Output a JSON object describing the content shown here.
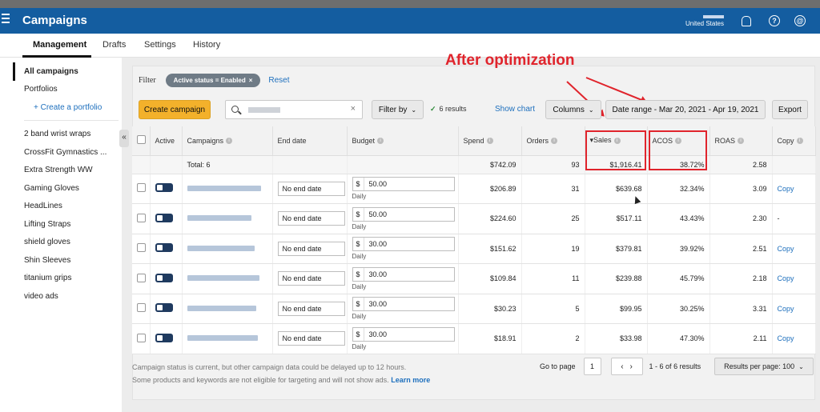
{
  "app": {
    "title": "Campaigns",
    "country": "United States"
  },
  "header_icons": [
    "bell-icon",
    "help-icon",
    "account-icon"
  ],
  "tabs": [
    {
      "label": "Management",
      "active": true
    },
    {
      "label": "Drafts",
      "active": false
    },
    {
      "label": "Settings",
      "active": false
    },
    {
      "label": "History",
      "active": false
    }
  ],
  "sidebar": {
    "top_items": [
      "All campaigns",
      "Portfolios"
    ],
    "create_portfolio": "+ Create a portfolio",
    "portfolios": [
      "2 band wrist wraps",
      "CrossFit Gymnastics ...",
      "Extra Strength WW",
      "Gaming Gloves",
      "HeadLines",
      "Lifting Straps",
      "shield gloves",
      "Shin Sleeves",
      "titanium grips",
      "video ads"
    ]
  },
  "filter": {
    "label": "Filter",
    "chip": "Active status = Enabled",
    "reset": "Reset"
  },
  "annotation": "After optimization",
  "toolbar": {
    "create": "Create campaign",
    "filter_by": "Filter by",
    "results": "6 results",
    "show_chart": "Show chart",
    "columns": "Columns",
    "date_range": "Date range - Mar 20, 2021 - Apr 19, 2021",
    "export": "Export"
  },
  "table": {
    "headers": {
      "active": "Active",
      "campaigns": "Campaigns",
      "end_date": "End date",
      "budget": "Budget",
      "spend": "Spend",
      "orders": "Orders",
      "sales": "Sales",
      "acos": "ACOS",
      "roas": "ROAS",
      "copy": "Copy"
    },
    "total": {
      "label": "Total: 6",
      "spend": "$742.09",
      "orders": "93",
      "sales": "$1,916.41",
      "acos": "38.72%",
      "roas": "2.58"
    },
    "rows": [
      {
        "end_date": "No end date",
        "currency": "$",
        "budget": "50.00",
        "daily": "Daily",
        "spend": "$206.89",
        "orders": "31",
        "sales": "$639.68",
        "acos": "32.34%",
        "roas": "3.09",
        "copy": "Copy"
      },
      {
        "end_date": "No end date",
        "currency": "$",
        "budget": "50.00",
        "daily": "Daily",
        "spend": "$224.60",
        "orders": "25",
        "sales": "$517.11",
        "acos": "43.43%",
        "roas": "2.30",
        "copy": "-"
      },
      {
        "end_date": "No end date",
        "currency": "$",
        "budget": "30.00",
        "daily": "Daily",
        "spend": "$151.62",
        "orders": "19",
        "sales": "$379.81",
        "acos": "39.92%",
        "roas": "2.51",
        "copy": "Copy"
      },
      {
        "end_date": "No end date",
        "currency": "$",
        "budget": "30.00",
        "daily": "Daily",
        "spend": "$109.84",
        "orders": "11",
        "sales": "$239.88",
        "acos": "45.79%",
        "roas": "2.18",
        "copy": "Copy"
      },
      {
        "end_date": "No end date",
        "currency": "$",
        "budget": "30.00",
        "daily": "Daily",
        "spend": "$30.23",
        "orders": "5",
        "sales": "$99.95",
        "acos": "30.25%",
        "roas": "3.31",
        "copy": "Copy"
      },
      {
        "end_date": "No end date",
        "currency": "$",
        "budget": "30.00",
        "daily": "Daily",
        "spend": "$18.91",
        "orders": "2",
        "sales": "$33.98",
        "acos": "47.30%",
        "roas": "2.11",
        "copy": "Copy"
      }
    ]
  },
  "footer": {
    "note1": "Campaign status is current, but other campaign data could be delayed up to 12 hours.",
    "note2": "Some products and keywords are not eligible for targeting and will not show ads.",
    "learn_more": "Learn more",
    "go_to_page": "Go to page",
    "page": "1",
    "range": "1 - 6 of 6 results",
    "per_page": "Results per page: 100"
  },
  "colors": {
    "topbar": "#145da0",
    "accent_link": "#1d6fbd",
    "create_button": "#f3b12b",
    "annotation": "#e0242c"
  }
}
